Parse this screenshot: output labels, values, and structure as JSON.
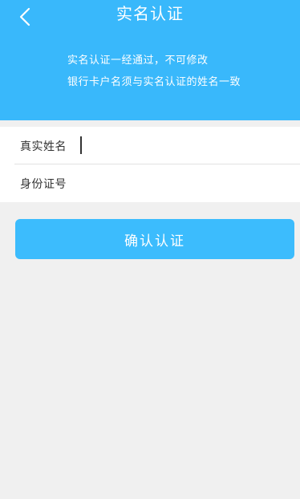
{
  "header": {
    "title": "实名认证",
    "notices": [
      "实名认证一经通过，不可修改",
      "银行卡户名须与实名认证的姓名一致"
    ]
  },
  "form": {
    "fields": [
      {
        "label": "真实姓名",
        "value": "",
        "placeholder": ""
      },
      {
        "label": "身份证号",
        "value": "",
        "placeholder": ""
      }
    ]
  },
  "actions": {
    "confirm_label": "确认认证"
  },
  "colors": {
    "header_bg": "#39b8fb",
    "button_bg": "#3cbcfd",
    "page_bg": "#f0f0f0"
  },
  "icons": {
    "back": "chevron-left-icon"
  }
}
